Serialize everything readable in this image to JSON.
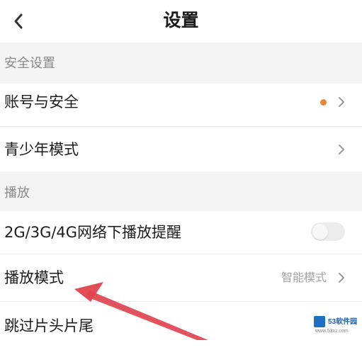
{
  "header": {
    "title": "设置",
    "back_icon": "chevron-left-icon"
  },
  "sections": {
    "security": {
      "label": "安全设置",
      "items": [
        {
          "label": "账号与安全",
          "has_dot": true,
          "dot_color": "#e8873a"
        },
        {
          "label": "青少年模式"
        }
      ]
    },
    "playback": {
      "label": "播放",
      "items": [
        {
          "label": "2G/3G/4G网络下播放提醒",
          "toggle_on": false
        },
        {
          "label": "播放模式",
          "value": "智能模式"
        },
        {
          "label": "跳过片头片尾"
        }
      ]
    }
  },
  "annotation": {
    "arrow_color": "#e0454f",
    "icon": "arrow-annotation"
  },
  "watermark": {
    "text": "53软件园",
    "url": "www.53xz.com",
    "logo_color": "#1f6fc5"
  }
}
